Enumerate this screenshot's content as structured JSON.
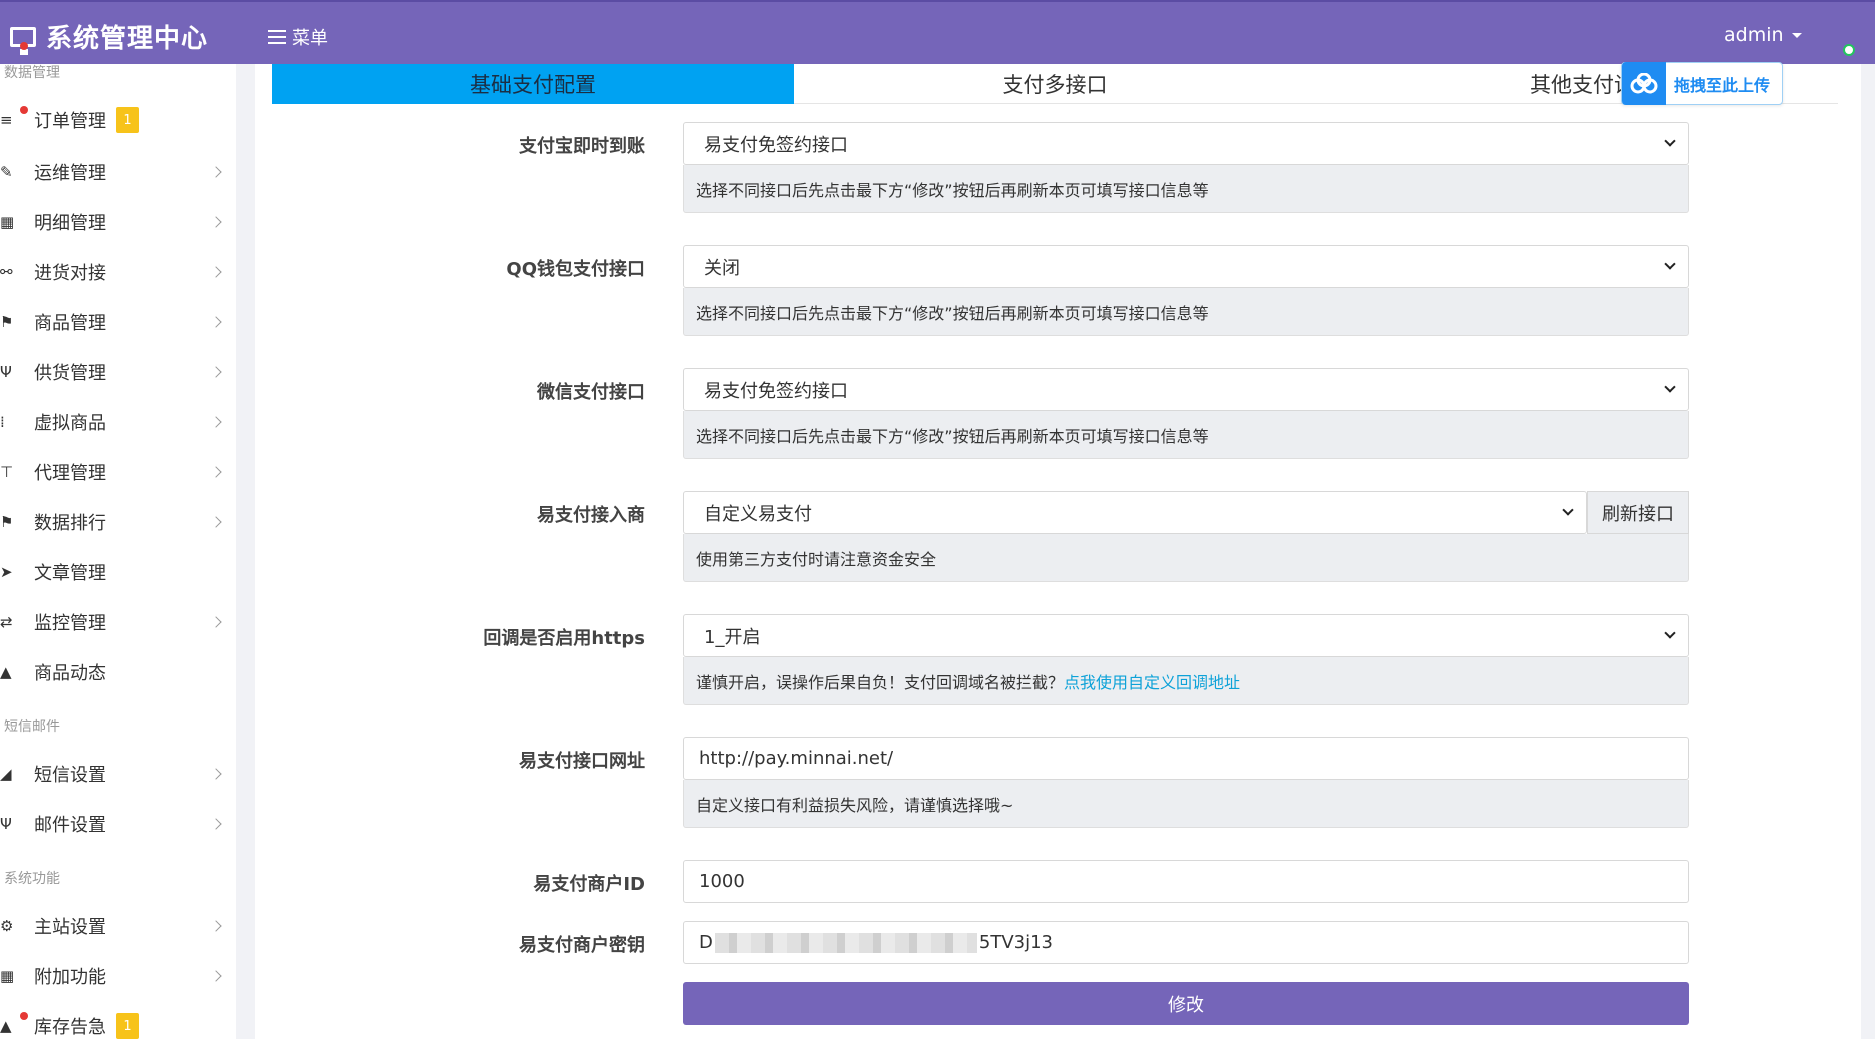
{
  "header": {
    "title": "系统管理中心",
    "menu_label": "菜单",
    "user": "admin"
  },
  "sidebar": {
    "sections": [
      "数据管理",
      "短信邮件",
      "系统功能"
    ],
    "items": [
      {
        "label": "订单管理",
        "badge": "1",
        "dot": true
      },
      {
        "label": "运维管理"
      },
      {
        "label": "明细管理"
      },
      {
        "label": "进货对接"
      },
      {
        "label": "商品管理"
      },
      {
        "label": "供货管理"
      },
      {
        "label": "虚拟商品"
      },
      {
        "label": "代理管理"
      },
      {
        "label": "数据排行"
      },
      {
        "label": "文章管理"
      },
      {
        "label": "监控管理"
      },
      {
        "label": "商品动态"
      },
      {
        "label": "短信设置"
      },
      {
        "label": "邮件设置"
      },
      {
        "label": "主站设置"
      },
      {
        "label": "附加功能"
      },
      {
        "label": "库存告急",
        "badge": "1",
        "dot": true
      }
    ]
  },
  "tabs": [
    "基础支付配置",
    "支付多接口",
    "其他支付设"
  ],
  "upload_widget": {
    "label": "拖拽至此上传"
  },
  "form": {
    "alipay": {
      "label": "支付宝即时到账",
      "value": "易支付免签约接口",
      "help": "选择不同接口后先点击最下方“修改”按钮后再刷新本页可填写接口信息等"
    },
    "qq": {
      "label": "QQ钱包支付接口",
      "value": "关闭",
      "help": "选择不同接口后先点击最下方“修改”按钮后再刷新本页可填写接口信息等"
    },
    "wechat": {
      "label": "微信支付接口",
      "value": "易支付免签约接口",
      "help": "选择不同接口后先点击最下方“修改”按钮后再刷新本页可填写接口信息等"
    },
    "provider": {
      "label": "易支付接入商",
      "value": "自定义易支付",
      "button": "刷新接口",
      "help": "使用第三方支付时请注意资金安全"
    },
    "https": {
      "label": "回调是否启用https",
      "value": "1_开启",
      "help": "谨慎开启，误操作后果自负！支付回调域名被拦截？",
      "help_link": "点我使用自定义回调地址"
    },
    "api_url": {
      "label": "易支付接口网址",
      "value": "http://pay.minnai.net/",
      "help": "自定义接口有利益损失风险，请谨慎选择哦~"
    },
    "merchant_id": {
      "label": "易支付商户ID",
      "value": "1000"
    },
    "merchant_key": {
      "label": "易支付商户密钥",
      "prefix": "D",
      "suffix": "5TV3j13"
    },
    "submit": "修改"
  },
  "colors": {
    "topbar": "#7565b9",
    "tab_active": "#00a2f2",
    "link": "#0ea2d8",
    "badge": "#f7c31a"
  }
}
